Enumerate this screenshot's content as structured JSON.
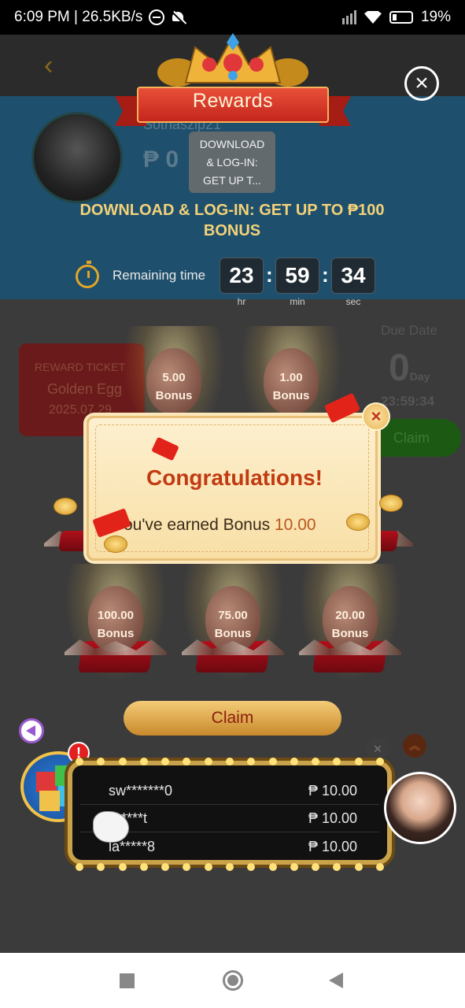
{
  "status_bar": {
    "time_speed": "6:09 PM | 26.5KB/s",
    "battery": "19%"
  },
  "background_page": {
    "username": "Sotnaszip21",
    "balance": "₱ 0",
    "ticket_label": "REWARD TICKET",
    "ticket_name": "Golden Egg",
    "ticket_date": "2025.07.29",
    "due_label": "Due Date",
    "due_days": "0",
    "due_days_unit": "Day",
    "due_time": "23:59:34",
    "claim_label": "Claim"
  },
  "rewards_modal": {
    "title": "Rewards",
    "tooltip": [
      "DOWNLOAD",
      "& LOG-IN:",
      "GET UP T..."
    ],
    "promo": "DOWNLOAD & LOG-IN: GET UP TO ₱100 BONUS",
    "timer_label": "Remaining time",
    "timer": {
      "hr": "23",
      "min": "59",
      "sec": "34"
    },
    "timer_units": {
      "hr": "hr",
      "min": "min",
      "sec": "sec"
    },
    "eggs": [
      {
        "amount": "5.00",
        "label": "Bonus"
      },
      {
        "amount": "1.00",
        "label": "Bonus"
      },
      {
        "amount": "100.00",
        "label": "Bonus"
      },
      {
        "amount": "75.00",
        "label": "Bonus"
      },
      {
        "amount": "20.00",
        "label": "Bonus"
      }
    ],
    "claim_label": "Claim"
  },
  "congrats_popup": {
    "title": "Congratulations!",
    "message_prefix": "ou've earned Bonus",
    "message_value": "10.00"
  },
  "winners": [
    {
      "name": "sw*******0",
      "amount": "₱ 10.00"
    },
    {
      "name": "****t",
      "amount": "₱ 10.00"
    },
    {
      "name": "la*****8",
      "amount": "₱ 10.00"
    }
  ],
  "badges": {
    "cube_alert": "!"
  },
  "colors": {
    "accent_gold": "#f3d27a",
    "title_red": "#c23a12",
    "ribbon_red": "#c4261c"
  }
}
